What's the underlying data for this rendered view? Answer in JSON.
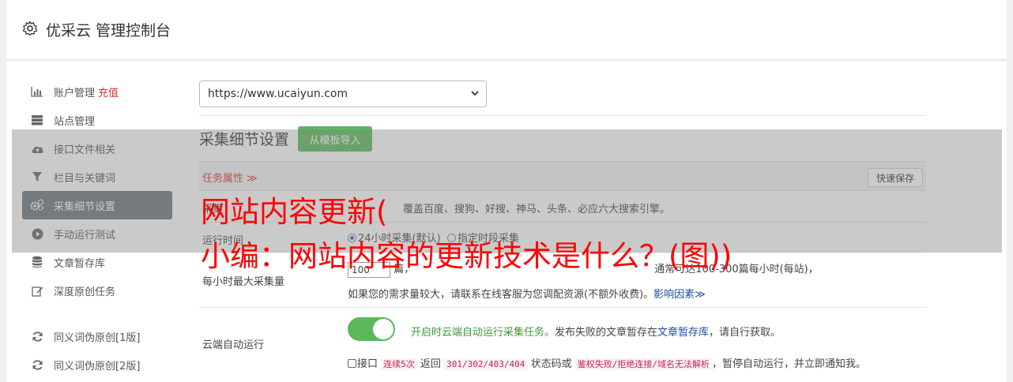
{
  "header": {
    "title": "优采云 管理控制台",
    "icon": "gear-icon"
  },
  "sidebar": {
    "items": [
      {
        "label": "账户管理",
        "badge": "充值",
        "icon": "bar-chart-icon"
      },
      {
        "label": "站点管理",
        "icon": "server-icon"
      },
      {
        "label": "接口文件相关",
        "icon": "cloud-upload-icon"
      },
      {
        "label": "栏目与关键词",
        "icon": "filter-icon"
      },
      {
        "label": "采集细节设置",
        "icon": "gears-icon",
        "active": true
      },
      {
        "label": "手动运行测试",
        "icon": "play-circle-icon"
      },
      {
        "label": "文章暂存库",
        "icon": "database-icon"
      },
      {
        "label": "深度原创任务",
        "icon": "edit-icon"
      },
      {
        "label": "同义词伪原创[1版]",
        "icon": "refresh-icon"
      },
      {
        "label": "同义词伪原创[2版]",
        "icon": "refresh-icon"
      }
    ]
  },
  "site_select": {
    "value": "https://www.ucaiyun.com"
  },
  "section": {
    "title": "采集细节设置",
    "import_button": "从模板导入"
  },
  "table": {
    "attr_header": "任务属性 ≫",
    "quick_save": "快速保存",
    "rows": {
      "source": {
        "label": "采集",
        "text": "覆盖百度、搜狗、好搜、神马、头条、必应六大搜索引擎。"
      },
      "runtime": {
        "label": "运行时间",
        "opt1": "24小时采集(默认)",
        "opt2": "指定时段采集"
      },
      "max": {
        "label": "每小时最大采集量",
        "value": "100",
        "line1_a": "篇，",
        "line1_b": "通常可达100-300篇每小时(每站)，",
        "line2": "如果您的需求量较大，请联系在线客服为您调配资源(不额外收费)。",
        "link": "影响因素≫"
      },
      "cloud": {
        "label": "云端自动运行",
        "text_green": "开启时云端自动运行采集任务。",
        "text_a": "发布失败的文章暂存在",
        "link": "文章暂存库",
        "text_b": "，请自行获取。",
        "chk_a": "接口",
        "code1": "连续5次",
        "chk_b": "返回",
        "code2": "301/302/403/404",
        "chk_c": "状态码或",
        "code3": "鉴权失败/拒绝连接/域名无法解析",
        "chk_d": "，暂停自动运行，并立即通知我。"
      }
    }
  },
  "overlay": {
    "line1": "网站内容更新(",
    "line2": "小编：网站内容的更新技术是什么？(图))"
  },
  "colors": {
    "accent_green": "#5cb85c",
    "active_nav": "#6c757d",
    "headline_red": "#ff0000"
  }
}
